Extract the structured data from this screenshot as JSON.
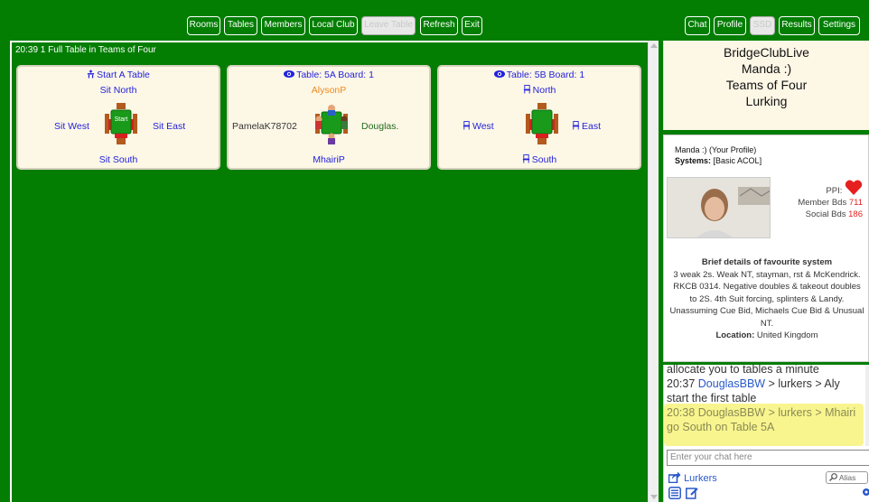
{
  "toolbar": {
    "rooms": "Rooms",
    "tables": "Tables",
    "members": "Members",
    "local_club": "Local Club",
    "leave_table": "Leave Table",
    "refresh": "Refresh",
    "exit": "Exit",
    "chat": "Chat",
    "profile": "Profile",
    "ssd": "SSD",
    "results": "Results",
    "settings": "Settings"
  },
  "status": "20:39 1 Full Table in Teams of Four",
  "tables": [
    {
      "head": "Start A Table",
      "north": "Sit North",
      "west": "Sit West",
      "east": "Sit East",
      "south": "Sit South",
      "center": "Start"
    },
    {
      "head": "Table: 5A Board: 1",
      "north": "AlysonP",
      "west": "PamelaK78702",
      "east": "Douglas.",
      "south": "MhairiP"
    },
    {
      "head": "Table: 5B Board: 1",
      "north": "North",
      "west": "West",
      "east": "East",
      "south": "South"
    }
  ],
  "info": {
    "name": "BridgeClubLive",
    "user": "Manda :)",
    "mode": "Teams of Four",
    "state": "Lurking"
  },
  "profile": {
    "header": "Manda :) (Your Profile)",
    "systems_label": "Systems:",
    "systems_value": "[Basic ACOL]",
    "ppi_label": "PPI:",
    "member_label": "Member Bds",
    "member_value": "711",
    "social_label": "Social Bds",
    "social_value": "186",
    "details_title": "Brief details of favourite system",
    "details_body": "3 weak 2s. Weak NT, stayman, rst & McKendrick. RKCB 0314. Negative doubles & takeout doubles to 2S. 4th Suit forcing, splinters & Landy. Unassuming Cue Bid, Michaels Cue Bid & Unusual NT.",
    "location_label": "Location:",
    "location_value": "United Kingdom"
  },
  "chat": {
    "line0": "allocate you to tables a minute",
    "line1_time": "20:37",
    "line1_who": "DouglasBBW",
    "line1_rest": "> lurkers > Aly",
    "line2": "start the first table",
    "line3_time": "20:38",
    "line3_who": "DouglasBBW",
    "line3_rest": "> lurkers > Mhairi",
    "line4": "go South on Table 5A",
    "input_placeholder": "Enter your chat here",
    "channel": "Lurkers",
    "alias": "Alias"
  },
  "colors": {
    "felt": "#037e03",
    "panel": "#fdf7e6",
    "link": "#2222dd",
    "highlight": "#f5f26a"
  }
}
